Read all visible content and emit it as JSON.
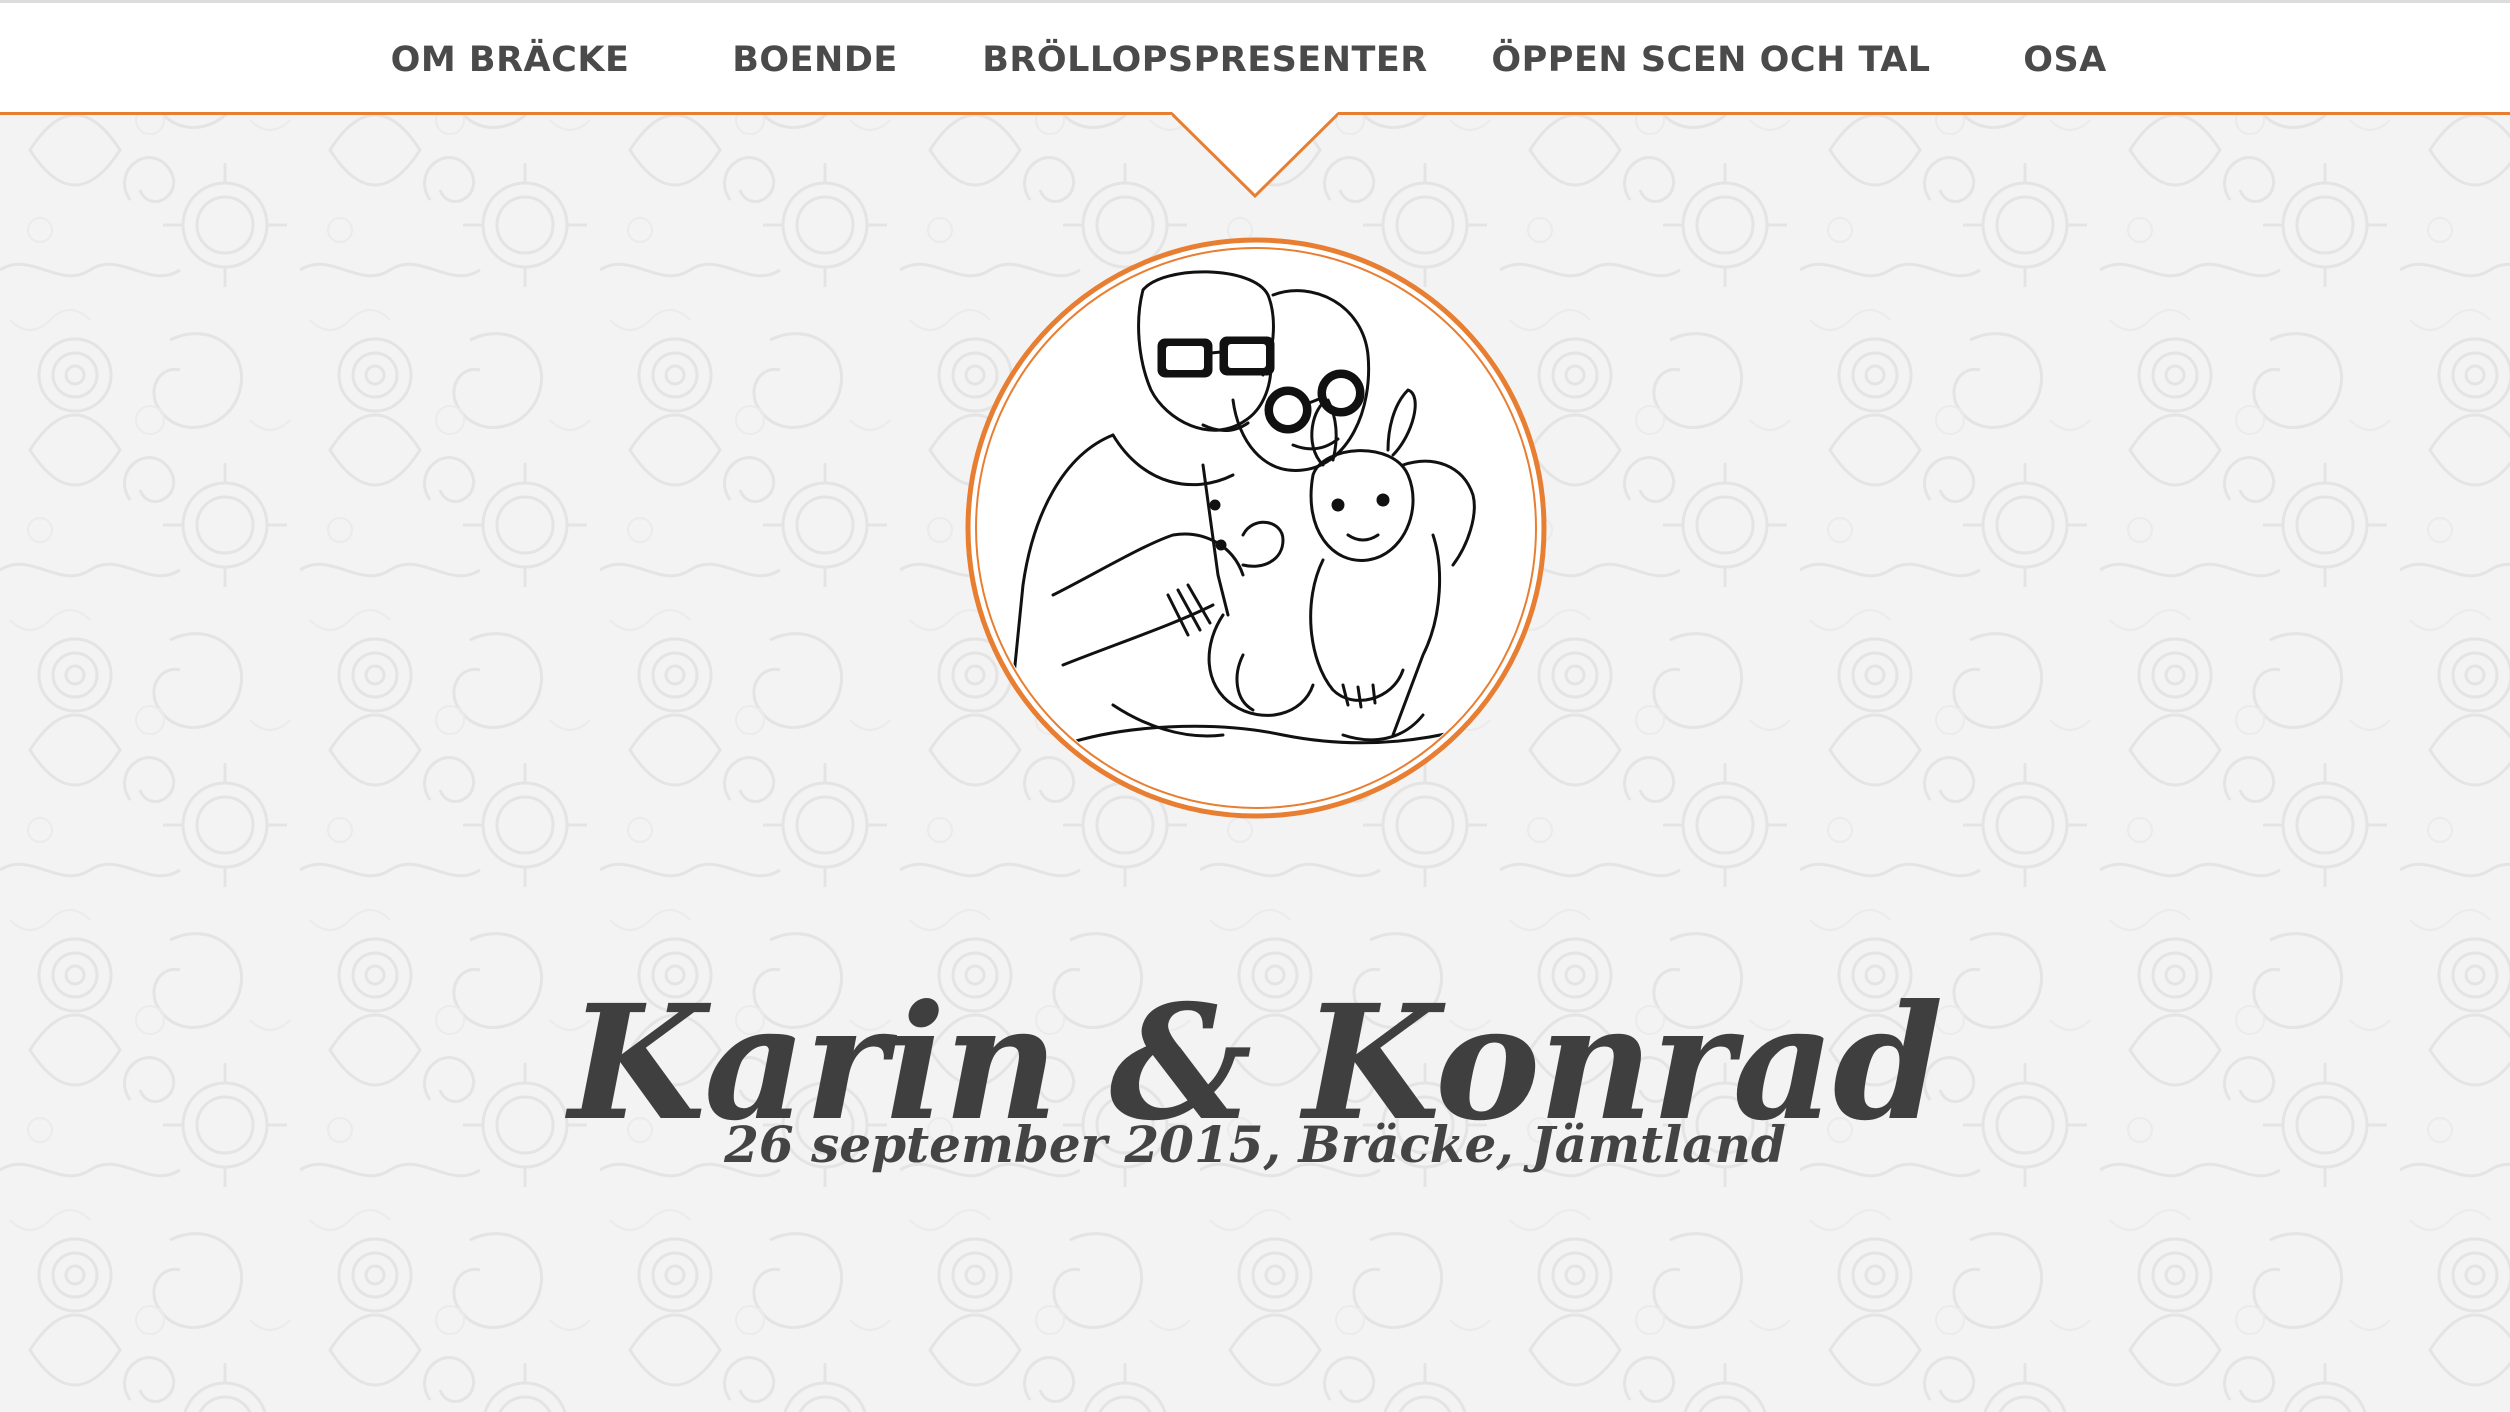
{
  "nav": {
    "items": [
      {
        "label": "OM BRÄCKE"
      },
      {
        "label": "BOENDE"
      },
      {
        "label": "BRÖLLOPSPRESENTER"
      },
      {
        "label": "ÖPPEN SCEN OCH TAL"
      },
      {
        "label": "OSA"
      }
    ]
  },
  "hero": {
    "title": "Karin & Konrad",
    "subtitle": "26 september 2015, Bräcke, Jämtland"
  },
  "colors": {
    "accent": "#e87e32",
    "text": "#444444",
    "nav_bg": "#ffffff",
    "page_bg": "#f3f3f3"
  },
  "icons": {
    "portrait": "couple-with-dog-illustration"
  }
}
